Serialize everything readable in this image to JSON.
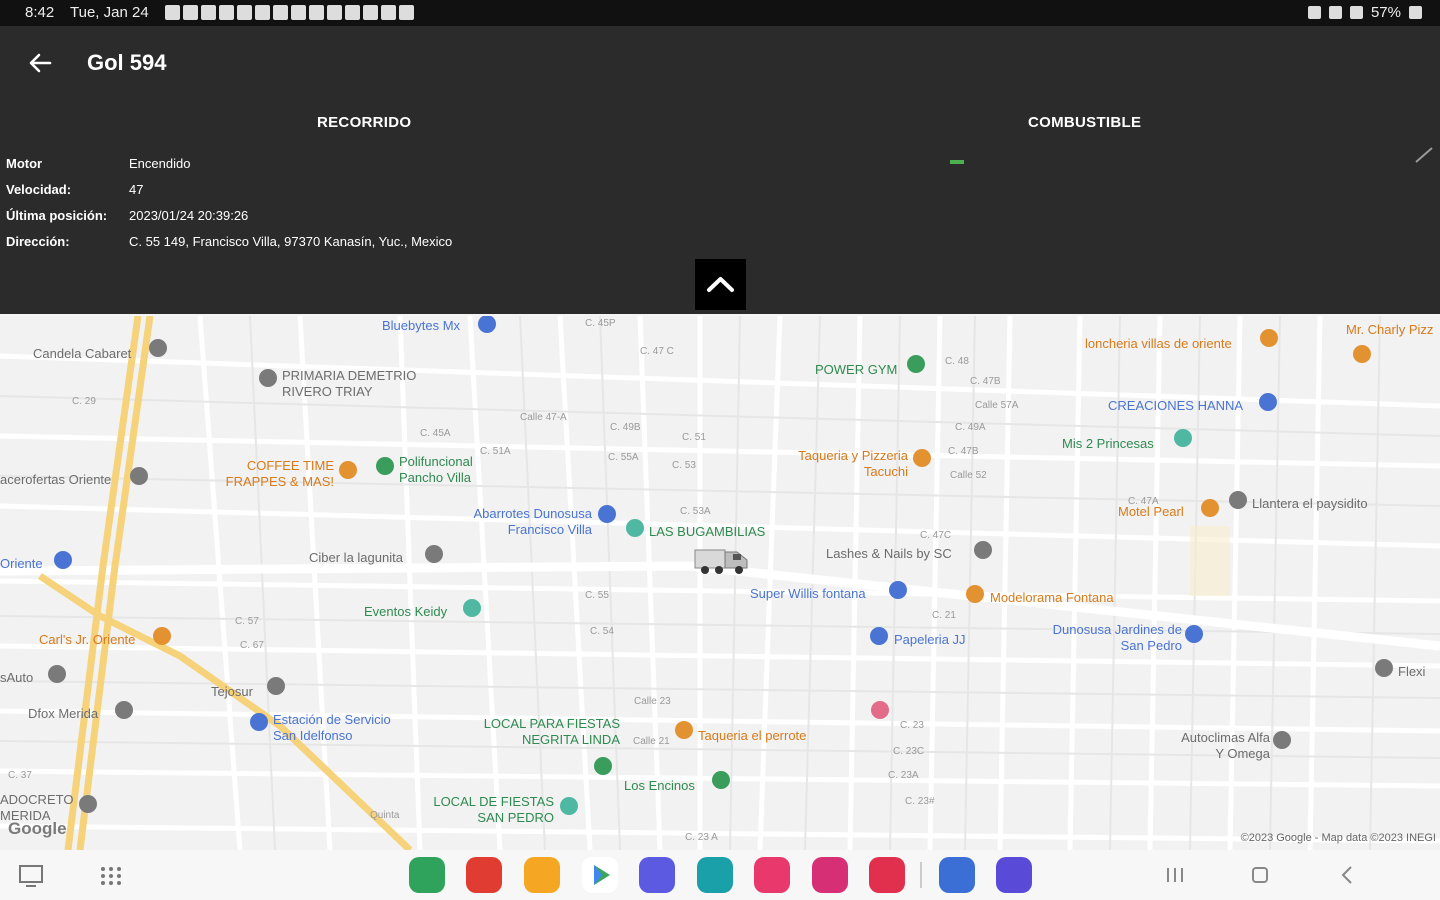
{
  "status_bar": {
    "time": "8:42",
    "date": "Tue, Jan 24",
    "battery": "57%"
  },
  "app_bar": {
    "title": "Gol 594"
  },
  "panel": {
    "tabs": [
      "RECORRIDO",
      "COMBUSTIBLE"
    ],
    "rows": [
      {
        "label": "Motor",
        "value": "Encendido"
      },
      {
        "label": "Velocidad:",
        "value": "47"
      },
      {
        "label": "Última posición:",
        "value": "2023/01/24 20:39:26"
      },
      {
        "label": "Dirección:",
        "value": "C. 55 149, Francisco Villa, 97370 Kanasín, Yuc., Mexico"
      }
    ]
  },
  "map": {
    "google_logo": "Google",
    "copyright": "©2023 Google - Map data ©2023 INEGI",
    "pois": [
      {
        "name": "Bluebytes Mx",
        "color": "blue"
      },
      {
        "name": "Candela Cabaret",
        "color": "grey"
      },
      {
        "name": "PRIMARIA DEMETRIO RIVERO TRIAY",
        "color": "grey"
      },
      {
        "name": "POWER GYM",
        "color": "green"
      },
      {
        "name": "loncheria villas de oriente",
        "color": "orange"
      },
      {
        "name": "Mr. Charly Pizz",
        "color": "orange"
      },
      {
        "name": "CREACIONES HANNA",
        "color": "blue"
      },
      {
        "name": "Mis 2 Princesas",
        "color": "green"
      },
      {
        "name": "COFFEE TIME FRAPPES & MAS!",
        "color": "orange"
      },
      {
        "name": "Polifuncional Pancho Villa",
        "color": "green"
      },
      {
        "name": "Taqueria y Pizzeria Tacuchi",
        "color": "orange"
      },
      {
        "name": "Abarrotes Dunosusa Francisco Villa",
        "color": "blue"
      },
      {
        "name": "LAS BUGAMBILIAS",
        "color": "green"
      },
      {
        "name": "Motel Pearl",
        "color": "orange"
      },
      {
        "name": "Llantera el paysidito",
        "color": "grey"
      },
      {
        "name": "Ciber la lagunita",
        "color": "grey"
      },
      {
        "name": "Lashes & Nails by SC",
        "color": "grey"
      },
      {
        "name": "Super Willis fontana",
        "color": "blue"
      },
      {
        "name": "Modelorama Fontana",
        "color": "orange"
      },
      {
        "name": "Eventos Keidy",
        "color": "green"
      },
      {
        "name": "Papeleria JJ",
        "color": "blue"
      },
      {
        "name": "Dunosusa Jardines de San Pedro",
        "color": "blue"
      },
      {
        "name": "Carl's Jr. Oriente",
        "color": "orange"
      },
      {
        "name": "Tejosur",
        "color": "grey"
      },
      {
        "name": "Estación de Servicio San Idelfonso",
        "color": "blue"
      },
      {
        "name": "LOCAL PARA FIESTAS NEGRITA LINDA",
        "color": "green"
      },
      {
        "name": "Taqueria el perrote",
        "color": "orange"
      },
      {
        "name": "Los Encinos",
        "color": "green"
      },
      {
        "name": "Autoclimas Alfa Y Omega",
        "color": "grey"
      },
      {
        "name": "LOCAL DE FIESTAS SAN PEDRO",
        "color": "green"
      },
      {
        "name": "Dfox Merida",
        "color": "grey"
      },
      {
        "name": "Oriente",
        "color": "blue"
      },
      {
        "name": "acerofertas Oriente",
        "color": "grey"
      },
      {
        "name": "sAuto",
        "color": "grey"
      },
      {
        "name": "ADOCRETO MERIDA",
        "color": "grey"
      },
      {
        "name": "Flexi",
        "color": "grey"
      }
    ],
    "streets": [
      "C. 45P",
      "C. 47 C",
      "C. 45A",
      "Calle 47-A",
      "C. 49B",
      "C. 51",
      "C. 51A",
      "C. 55A",
      "C. 53A",
      "C. 55",
      "C. 54",
      "C. 53",
      "C. 57",
      "Calle 23",
      "C. 23",
      "C. 23C",
      "C. 23A",
      "C. 23#",
      "C. 21",
      "C. 48",
      "C. 49A",
      "C. 47B",
      "C. 47C",
      "C. 47A",
      "C. 47B",
      "Calle 52",
      "Calle 57A",
      "C. 67",
      "Calle 21",
      "C. 29",
      "C. 23 A",
      "C. 37",
      "Quinta"
    ]
  },
  "nav": {
    "dock_apps": [
      "phone",
      "notes",
      "files",
      "play-store",
      "messages",
      "calendar",
      "store",
      "gallery",
      "camera",
      "browser",
      "pen-app"
    ]
  },
  "colors": {
    "panel_bg": "#2b2b2b",
    "status_bg": "#111111",
    "highway": "#f6d27a",
    "fuel_indicator": "#4caf50"
  }
}
